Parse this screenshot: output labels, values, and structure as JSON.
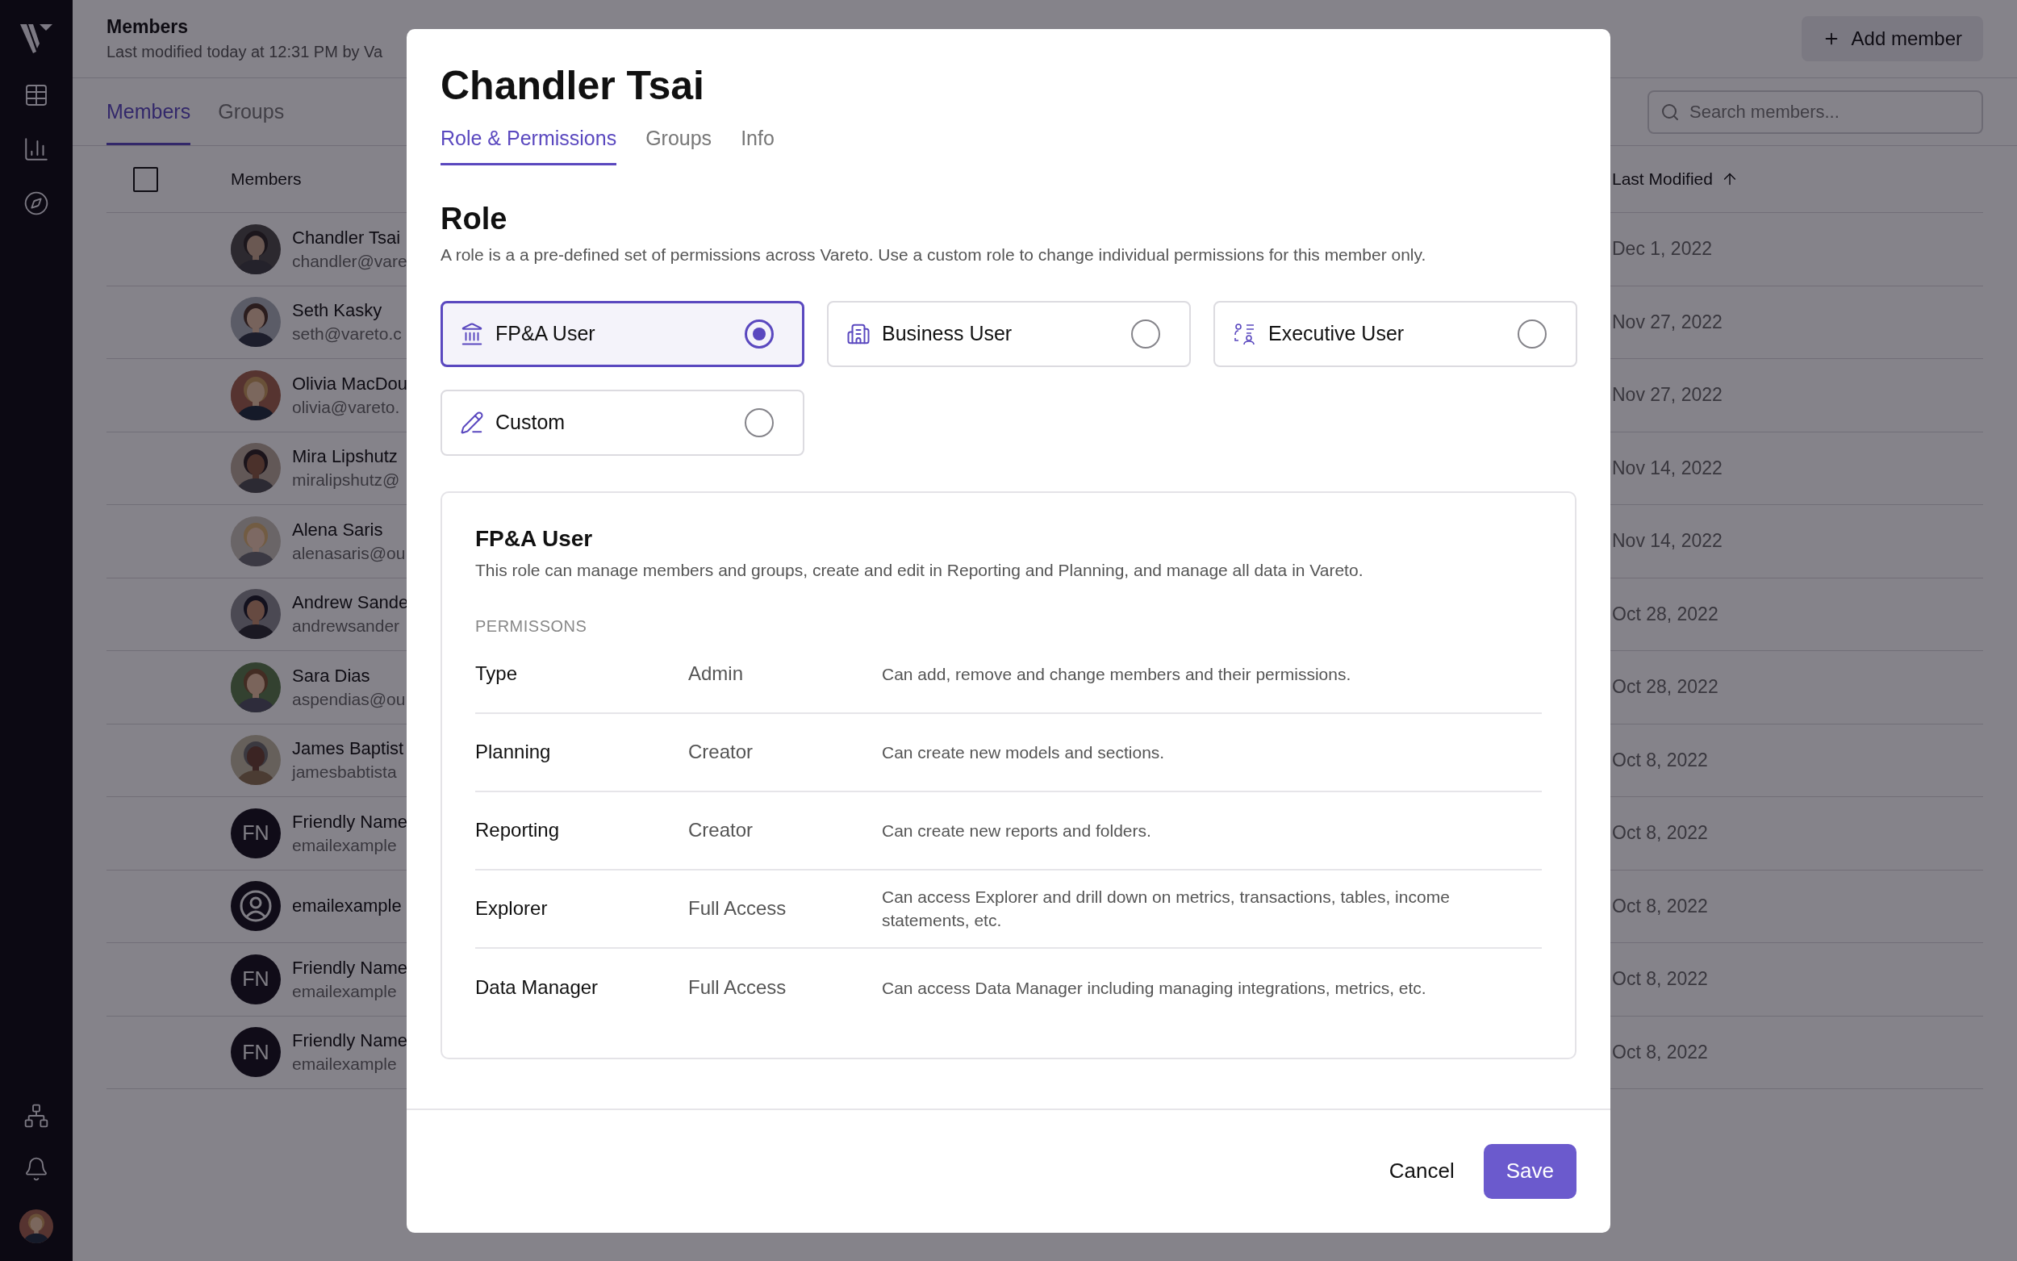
{
  "header": {
    "title": "Members",
    "subtitle": "Last modified today at 12:31 PM by Va",
    "add_button": "Add member"
  },
  "page_tabs": [
    {
      "label": "Members",
      "selected": true
    },
    {
      "label": "Groups",
      "selected": false
    }
  ],
  "search": {
    "placeholder": "Search members..."
  },
  "table": {
    "select_all": {
      "checked": false
    },
    "columns": [
      "Members",
      "Last Modified"
    ],
    "rows": [
      {
        "name": "Chandler Tsai",
        "email": "chandler@vare",
        "modified": "Dec 1, 2022"
      },
      {
        "name": "Seth Kasky",
        "email": "seth@vareto.c",
        "modified": "Nov 27, 2022"
      },
      {
        "name": "Olivia MacDou",
        "email": "olivia@vareto.",
        "modified": "Nov 27, 2022"
      },
      {
        "name": "Mira Lipshutz",
        "email": "miralipshutz@",
        "modified": "Nov 14, 2022"
      },
      {
        "name": "Alena Saris",
        "email": "alenasaris@ou",
        "modified": "Nov 14, 2022"
      },
      {
        "name": "Andrew Sande",
        "email": "andrewsander",
        "modified": "Oct 28, 2022"
      },
      {
        "name": "Sara Dias",
        "email": "aspendias@ou",
        "modified": "Oct 28, 2022"
      },
      {
        "name": "James Baptist",
        "email": "jamesbabtista",
        "modified": "Oct 8, 2022"
      },
      {
        "avatar": {
          "kind": "initials",
          "initials": "FN"
        },
        "name": "Friendly Name",
        "email": "emailexample",
        "modified": "Oct 8, 2022"
      },
      {
        "avatar": {
          "kind": "icon"
        },
        "name": "emailexample",
        "modified": "Oct 8, 2022"
      },
      {
        "avatar": {
          "kind": "initials",
          "initials": "FN"
        },
        "name": "Friendly Name",
        "email": "emailexample",
        "modified": "Oct 8, 2022"
      },
      {
        "avatar": {
          "kind": "initials",
          "initials": "FN"
        },
        "name": "Friendly Name",
        "email": "emailexample",
        "modified": "Oct 8, 2022"
      }
    ]
  },
  "modal": {
    "title": "Chandler Tsai",
    "tabs": [
      {
        "label": "Role & Permissions",
        "selected": true
      },
      {
        "label": "Groups",
        "selected": false
      },
      {
        "label": "Info",
        "selected": false
      }
    ],
    "role_heading": "Role",
    "role_description": "A role is a a pre-defined set of permissions across Vareto.  Use a custom role to change individual permissions for this member only.",
    "roles": [
      {
        "label": "FP&A User",
        "kind": "bank",
        "selected": true
      },
      {
        "label": "Business User",
        "kind": "building",
        "selected": false
      },
      {
        "label": "Executive User",
        "kind": "people",
        "selected": false
      },
      {
        "label": "Custom",
        "kind": "pencil",
        "selected": false
      }
    ],
    "detail": {
      "title": "FP&A User",
      "description": "This role can manage members and groups, create and edit in Reporting and Planning, and manage all data in Vareto.",
      "section_label": "PERMISSONS",
      "permissions": [
        {
          "name": "Type",
          "access": "Admin",
          "description": "Can add, remove and change members and their permissions."
        },
        {
          "name": "Planning",
          "access": "Creator",
          "description": "Can create new models and sections."
        },
        {
          "name": "Reporting",
          "access": "Creator",
          "description": "Can create new reports and folders."
        },
        {
          "name": "Explorer",
          "access": "Full Access",
          "description": "Can access Explorer and drill down on metrics, transactions, tables, income statements, etc."
        },
        {
          "name": "Data Manager",
          "access": "Full Access",
          "description": "Can access Data Manager including managing integrations, metrics, etc."
        }
      ]
    },
    "cancel": "Cancel",
    "save": "Save"
  }
}
